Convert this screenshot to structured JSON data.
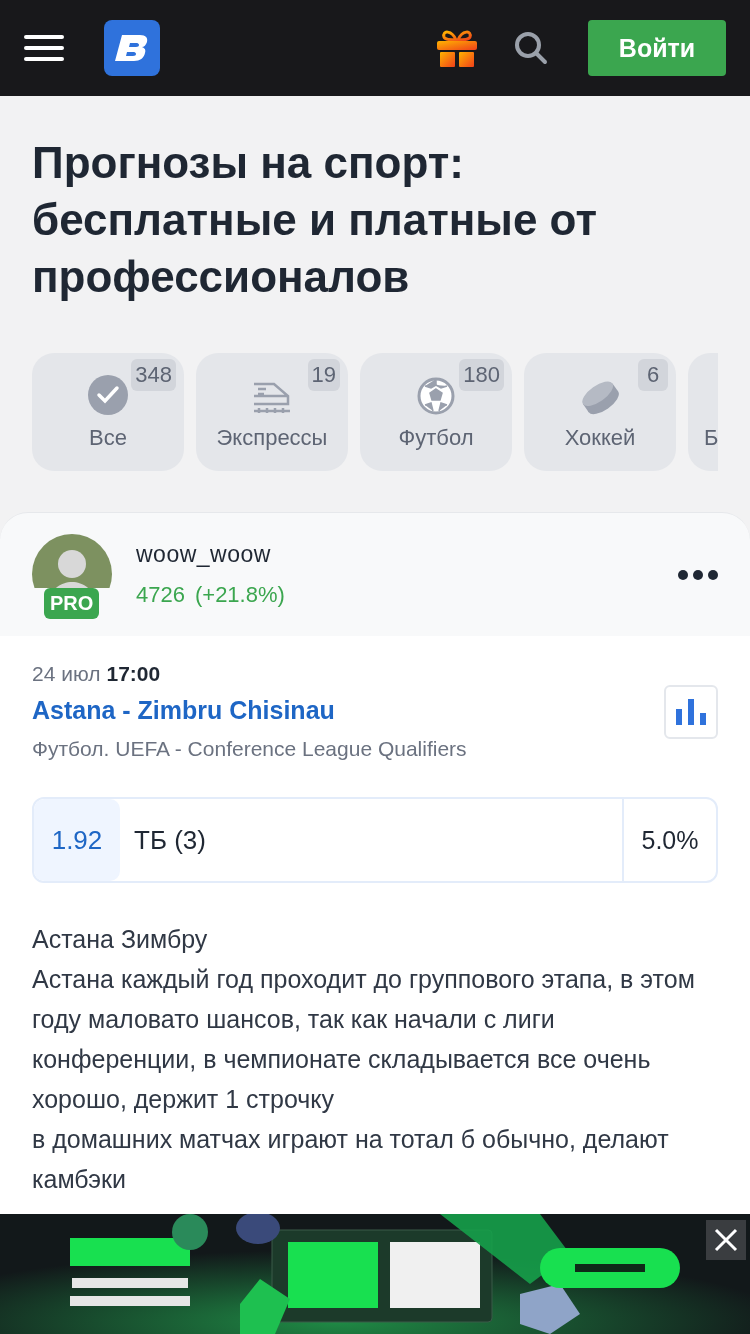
{
  "header": {
    "login_button": "Войти"
  },
  "title": "Прогнозы на спорт: бесплатные и платные от профессионалов",
  "categories": [
    {
      "kind": "all",
      "label": "Все",
      "count": "348"
    },
    {
      "kind": "express",
      "label": "Экспрессы",
      "count": "19"
    },
    {
      "kind": "football",
      "label": "Футбол",
      "count": "180"
    },
    {
      "kind": "hockey",
      "label": "Хоккей",
      "count": "6"
    },
    {
      "kind": "cut",
      "label": "Б"
    }
  ],
  "tip": {
    "author": {
      "name": "woow_woow",
      "badge": "PRO",
      "rating": "4726",
      "change": "(+21.8%)"
    },
    "date": "24 июл",
    "time": "17:00",
    "match": "Astana - Zimbru Chisinau",
    "league": "Футбол. UEFA - Conference League Qualifiers",
    "odds": "1.92",
    "bet": "ТБ (3)",
    "stake": "5.0%",
    "text": [
      "Астана Зимбру",
      "Астана каждый год проходит до группового этапа, в этом году маловато шансов, так как начали с лиги конференции, в чемпионате складывается все очень хорошо, держит 1 строчку",
      "в домашних матчах играют на тотал б обычно, делают камбэки"
    ]
  }
}
